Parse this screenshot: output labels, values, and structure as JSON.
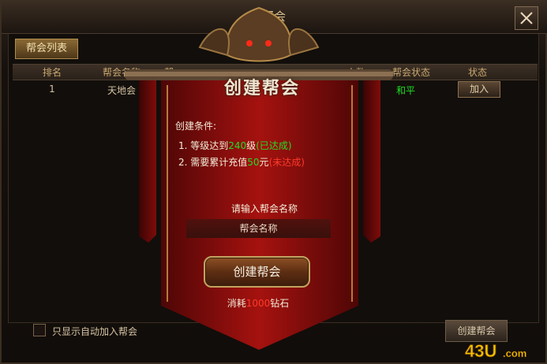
{
  "window": {
    "title": "帮会",
    "close_icon": "close-icon"
  },
  "tabs": [
    {
      "label": "帮会列表",
      "active": true
    }
  ],
  "table": {
    "headers": [
      "排名",
      "帮会名称",
      "帮",
      "人数",
      "帮会状态",
      "状态"
    ],
    "rows": [
      {
        "rank": "1",
        "name": "天地会",
        "state": "和平",
        "action": "加入"
      }
    ]
  },
  "footer": {
    "checkbox_label": "只显示自动加入帮会",
    "checkbox_checked": false,
    "create_button": "创建帮会"
  },
  "dialog": {
    "title": "创建帮会",
    "conditions_title": "创建条件:",
    "conditions": [
      {
        "prefix": "1. 等级达到",
        "value": "240",
        "suffix": "级",
        "status": "(已达成)",
        "status_color": "#20dd26"
      },
      {
        "prefix": "2. 需要累计充值",
        "value": "50",
        "suffix": "元",
        "status": "(未达成)",
        "status_color": "#ff3a2a"
      }
    ],
    "name_prompt": "请输入帮会名称",
    "name_placeholder": "帮会名称",
    "create_button": "创建帮会",
    "cost_prefix": "消耗",
    "cost_value": "1000",
    "cost_suffix": "钻石"
  },
  "watermark": "43U.com",
  "colors": {
    "accent_gold": "#c9a870",
    "banner_red": "#8b0d0b",
    "ok_green": "#20dd26",
    "fail_red": "#ff3a2a"
  }
}
